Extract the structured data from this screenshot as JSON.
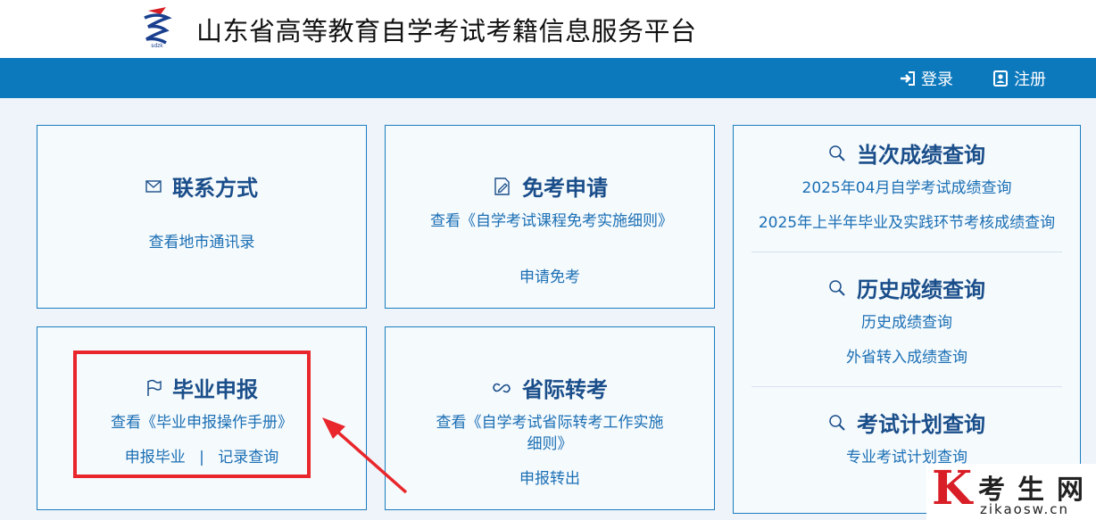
{
  "header": {
    "title": "山东省高等教育自学考试考籍信息服务平台",
    "logo_icon": "sdzk-logo-icon"
  },
  "nav": {
    "login": "登录",
    "register": "注册"
  },
  "cards": {
    "contact": {
      "title": "联系方式",
      "links": [
        "查看地市通讯录"
      ]
    },
    "exemption": {
      "title": "免考申请",
      "links": [
        "查看《自学考试课程免考实施细则》",
        "申请免考"
      ]
    },
    "scores": {
      "sections": [
        {
          "title": "当次成绩查询",
          "links": [
            "2025年04月自学考试成绩查询",
            "2025年上半年毕业及实践环节考核成绩查询"
          ]
        },
        {
          "title": "历史成绩查询",
          "links": [
            "历史成绩查询",
            "外省转入成绩查询"
          ]
        },
        {
          "title": "考试计划查询",
          "links": [
            "专业考试计划查询"
          ]
        }
      ]
    },
    "graduation": {
      "title": "毕业申报",
      "links": [
        "查看《毕业申报操作手册》",
        "申报毕业",
        "记录查询"
      ],
      "separator": "|"
    },
    "transfer": {
      "title": "省际转考",
      "links": [
        "查看《自学考试省际转考工作实施细则》",
        "申报转出"
      ]
    }
  },
  "watermark": {
    "letter": "K",
    "chinese": "考生网",
    "domain": "zikaosw.cn"
  },
  "colors": {
    "nav_bg": "#0d79bd",
    "card_border": "#1b7cbf",
    "title": "#1a4e8a",
    "link": "#1b6fb4",
    "highlight": "#e8262b"
  }
}
